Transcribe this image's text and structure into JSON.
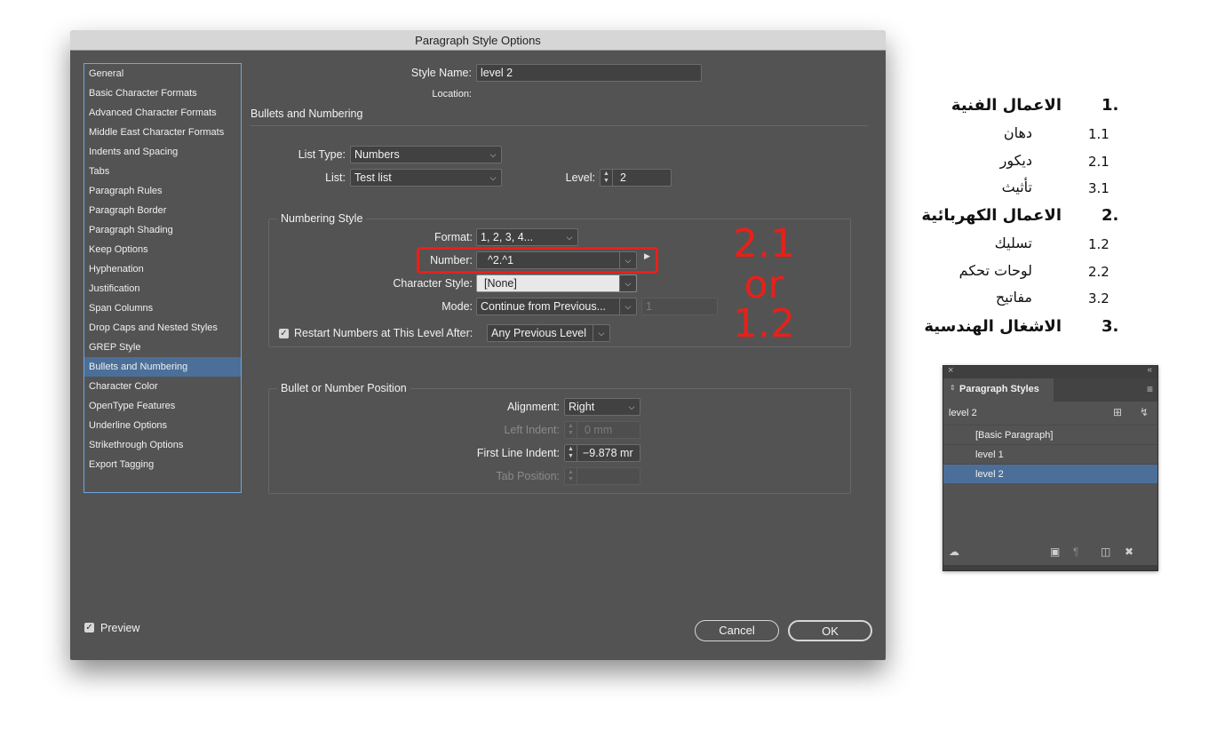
{
  "dialog": {
    "title": "Paragraph Style Options",
    "categories": [
      "General",
      "Basic Character Formats",
      "Advanced Character Formats",
      "Middle East Character Formats",
      "Indents and Spacing",
      "Tabs",
      "Paragraph Rules",
      "Paragraph Border",
      "Paragraph Shading",
      "Keep Options",
      "Hyphenation",
      "Justification",
      "Span Columns",
      "Drop Caps and Nested Styles",
      "GREP Style",
      "Bullets and Numbering",
      "Character Color",
      "OpenType Features",
      "Underline Options",
      "Strikethrough Options",
      "Export Tagging"
    ],
    "selected_category": "Bullets and Numbering",
    "style_name_label": "Style Name:",
    "style_name_value": "level 2",
    "location_label": "Location:",
    "section_title": "Bullets and Numbering",
    "list_type_label": "List Type:",
    "list_type_value": "Numbers",
    "list_label": "List:",
    "list_value": "Test list",
    "level_label": "Level:",
    "level_value": "2",
    "numbering_style": {
      "title": "Numbering Style",
      "format_label": "Format:",
      "format_value": "1, 2, 3, 4...",
      "number_label": "Number:",
      "number_value": "^2.^1",
      "char_style_label": "Character Style:",
      "char_style_value": "[None]",
      "mode_label": "Mode:",
      "mode_value": "Continue from Previous...",
      "mode_start_value": "1",
      "restart_label": "Restart Numbers at This Level After:",
      "restart_value": "Any Previous Level",
      "restart_checked": true
    },
    "position": {
      "title": "Bullet or Number Position",
      "alignment_label": "Alignment:",
      "alignment_value": "Right",
      "left_indent_label": "Left Indent:",
      "left_indent_value": "0 mm",
      "first_line_label": "First Line Indent:",
      "first_line_value": "−9.878 mr",
      "tab_position_label": "Tab Position:"
    },
    "preview_label": "Preview",
    "preview_checked": true,
    "cancel_label": "Cancel",
    "ok_label": "OK"
  },
  "annotation": {
    "line1": "2.1",
    "line2": "or",
    "line3": "1.2",
    "color": "#e8201a"
  },
  "arabic_list": [
    {
      "num": "1.",
      "text": "الاعمال الفنية",
      "level": 1
    },
    {
      "num": "1.1",
      "text": "دهان",
      "level": 2
    },
    {
      "num": "2.1",
      "text": "ديكور",
      "level": 2
    },
    {
      "num": "3.1",
      "text": "تأثيث",
      "level": 2
    },
    {
      "num": "2.",
      "text": "الاعمال الكهربائية",
      "level": 1
    },
    {
      "num": "1.2",
      "text": "تسليك",
      "level": 2
    },
    {
      "num": "2.2",
      "text": "لوحات تحكم",
      "level": 2
    },
    {
      "num": "3.2",
      "text": "مفاتيح",
      "level": 2
    },
    {
      "num": "3.",
      "text": "الاشغال الهندسية",
      "level": 1
    }
  ],
  "panel": {
    "title": "Paragraph Styles",
    "current_style": "level 2",
    "styles": [
      "[Basic Paragraph]",
      "level 1",
      "level 2"
    ],
    "selected_style": "level 2"
  }
}
